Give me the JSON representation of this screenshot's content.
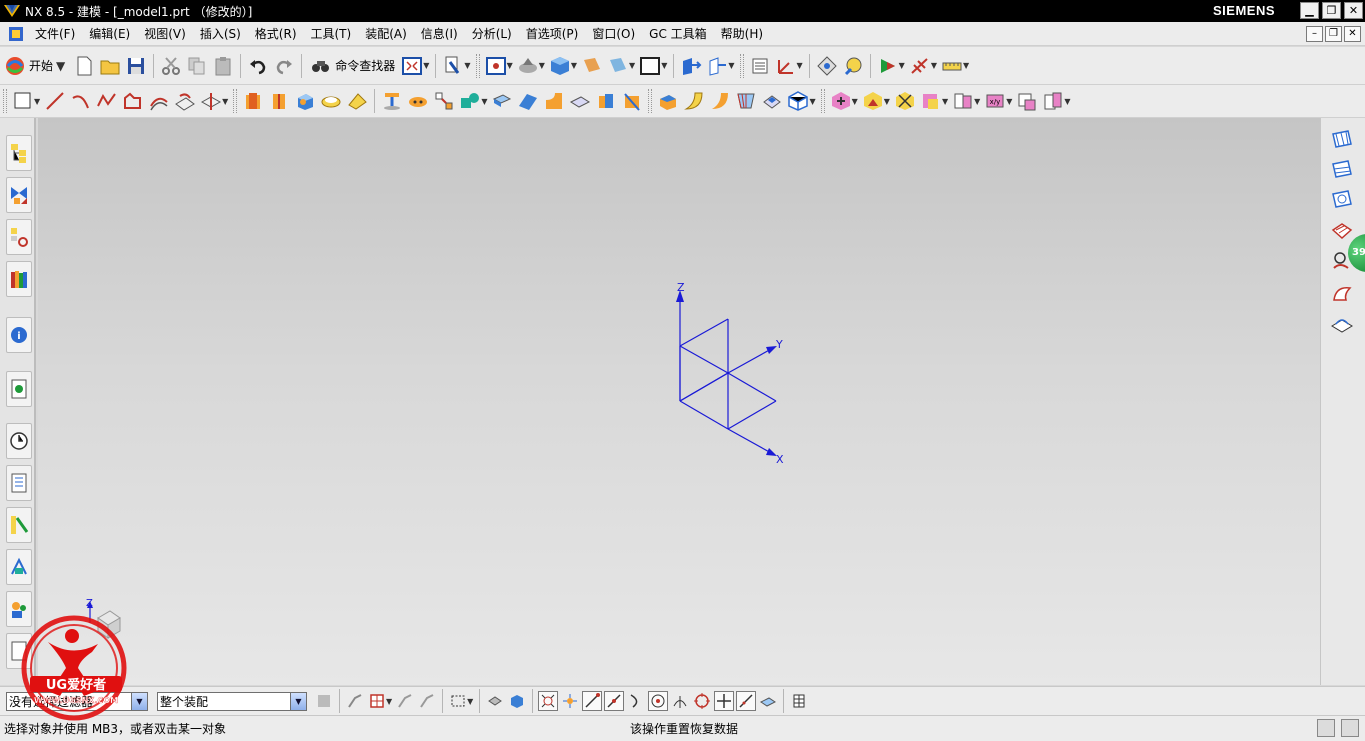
{
  "window": {
    "title": "NX 8.5 - 建模 - [_model1.prt （修改的）]",
    "brand": "SIEMENS",
    "buttons": [
      "minimize",
      "restore",
      "close"
    ]
  },
  "menu": {
    "items": [
      "文件(F)",
      "编辑(E)",
      "视图(V)",
      "插入(S)",
      "格式(R)",
      "工具(T)",
      "装配(A)",
      "信息(I)",
      "分析(L)",
      "首选项(P)",
      "窗口(O)",
      "GC 工具箱",
      "帮助(H)"
    ]
  },
  "toolbar_standard": {
    "start_label": "开始",
    "command_finder_label": "命令查找器",
    "icons": [
      "new-file-icon",
      "open-folder-icon",
      "save-icon",
      "cut-icon",
      "copy-icon",
      "paste-icon",
      "undo-icon",
      "redo-icon"
    ]
  },
  "viewport": {
    "wcs_axis_labels": {
      "z": "Z",
      "y": "Y",
      "x": "X"
    },
    "triad_axis_label": "Z"
  },
  "right_badge": "39",
  "selection_bar": {
    "type_filter_value": "没有选择过滤器",
    "scope_value": "整个装配"
  },
  "status": {
    "prompt": "选择对象并使用 MB3，或者双击某一对象",
    "message": "该操作重置恢复数据"
  },
  "watermark": {
    "brand": "UG爱好者",
    "url": "WWW.UGSNX.COM"
  },
  "colors": {
    "wcs_blue": "#1a1ad6",
    "title_bar": "#000000",
    "watermark_red": "#e01010"
  }
}
